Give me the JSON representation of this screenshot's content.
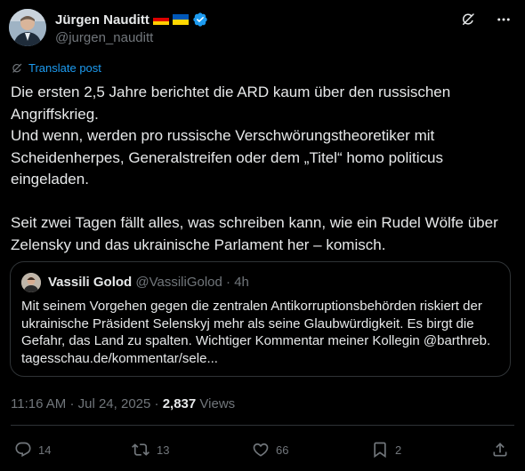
{
  "author": {
    "name": "Jürgen Nauditt",
    "handle": "@jurgen_nauditt"
  },
  "icons": {
    "flags": [
      "germany-flag-icon",
      "ukraine-flag-icon"
    ],
    "verified": "verified-badge-icon",
    "top_right": [
      "grok-icon",
      "more-icon"
    ],
    "translate": "translate-icon"
  },
  "translate_label": "Translate post",
  "post": {
    "lines": [
      "Die ersten 2,5 Jahre berichtet die ARD kaum über den russischen",
      "Angriffskrieg.",
      "Und wenn, werden pro russische Verschwörungstheoretiker mit",
      "Scheidenherpes, Generalstreifen oder dem „Titel“ homo politicus",
      "eingeladen.",
      "",
      "Seit zwei Tagen fällt alles, was schreiben kann, wie ein Rudel Wölfe über",
      "Zelensky und das ukrainische Parlament her – komisch."
    ]
  },
  "quote": {
    "name": "Vassili Golod",
    "handle": "@VassiliGolod",
    "separator": "·",
    "time": "4h",
    "lines": [
      "Mit seinem Vorgehen gegen die zentralen Antikorruptionsbehörden riskiert der",
      "ukrainische Präsident Selenskyj mehr als seine Glaubwürdigkeit. Es birgt die",
      "Gefahr, das Land zu spalten. Wichtiger Kommentar meiner Kollegin @barthreb.",
      "tagesschau.de/kommentar/sele..."
    ]
  },
  "meta": {
    "time": "11:16 AM",
    "separator": "·",
    "date": "Jul 24, 2025",
    "separator2": "·",
    "views_count": "2,837",
    "views_label": "Views"
  },
  "actions": {
    "replies": "14",
    "reposts": "13",
    "likes": "66",
    "bookmarks": "2"
  },
  "colors": {
    "background": "#000000",
    "text": "#e7e9ea",
    "muted": "#71767b",
    "accent": "#1d9bf0",
    "border": "#2f3336"
  }
}
